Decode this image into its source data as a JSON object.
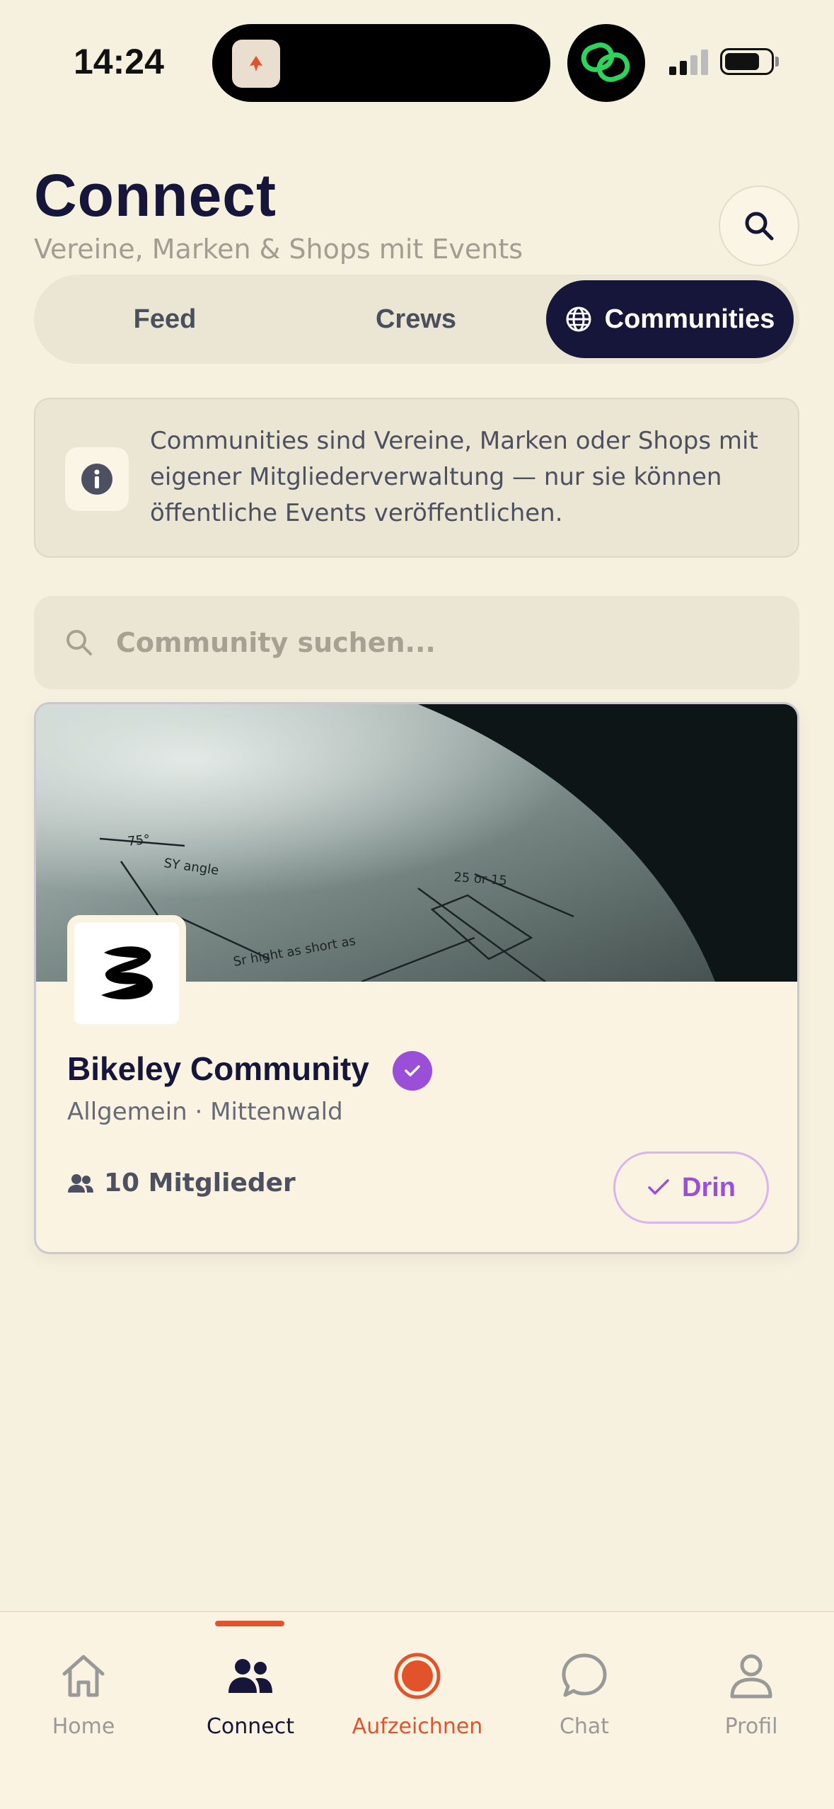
{
  "status_bar": {
    "time": "14:24"
  },
  "header": {
    "title": "Connect",
    "subtitle": "Vereine, Marken & Shops mit Events"
  },
  "segments": {
    "items": [
      "Feed",
      "Crews",
      "Communities"
    ],
    "active": "Communities"
  },
  "info": {
    "text": "Communities sind Vereine, Marken oder Shops mit eigener Mitgliederverwaltung — nur sie können öffentliche Events veröffentlichen."
  },
  "search": {
    "placeholder": "Community suchen..."
  },
  "community": {
    "name": "Bikeley Community",
    "meta": "Allgemein · Mittenwald",
    "members": "10 Mitglieder",
    "join_state": "Drin",
    "verified": true
  },
  "tabbar": {
    "items": [
      {
        "label": "Home",
        "icon": "home-icon"
      },
      {
        "label": "Connect",
        "icon": "people-icon"
      },
      {
        "label": "Aufzeichnen",
        "icon": "record-icon"
      },
      {
        "label": "Chat",
        "icon": "chat-icon"
      },
      {
        "label": "Profil",
        "icon": "person-icon"
      }
    ],
    "active": "Connect"
  },
  "colors": {
    "background": "#f6f0df",
    "primary": "#15163a",
    "accent_purple": "#9b4fd9",
    "accent_orange": "#e2532c"
  }
}
